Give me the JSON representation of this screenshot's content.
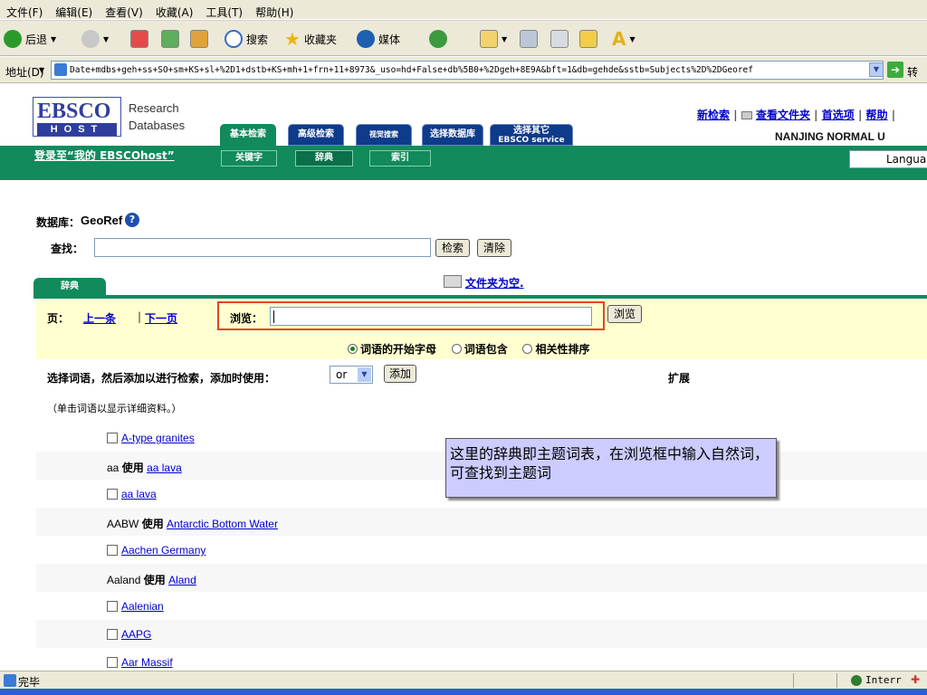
{
  "menubar": [
    "文件(F)",
    "编辑(E)",
    "查看(V)",
    "收藏(A)",
    "工具(T)",
    "帮助(H)"
  ],
  "toolbar": {
    "back": "后退",
    "search": "搜索",
    "favorites": "收藏夹",
    "media": "媒体"
  },
  "address": {
    "label": "地址(D)",
    "url": "Date+mdbs+geh+ss+SO+sm+KS+sl+%2D1+dstb+KS+mh+1+frn+11+8973&_uso=hd+False+db%5B0+%2Dgeh+8E9A&bft=1&db=gehde&sstb=Subjects%2D%2DGeoref",
    "go": "转"
  },
  "logo": {
    "brand": "EBSCO",
    "host": "HOST",
    "line1": "Research",
    "line2": "Databases"
  },
  "tabs": [
    "基本检索",
    "高级检索",
    "视觉搜索",
    "选择数据库",
    "选择其它",
    "EBSCO service"
  ],
  "toplinks": {
    "new_search": "新检索",
    "view_folder": "查看文件夹",
    "preferences": "首选项",
    "help": "帮助"
  },
  "institution": "NANJING NORMAL U",
  "login": "登录至“我的 EBSCOhost”",
  "subtabs": [
    "关键字",
    "辞典",
    "索引"
  ],
  "language": "Languag",
  "database": {
    "label": "数据库：",
    "name": "GeoRef"
  },
  "find": {
    "label": "查找：",
    "search_btn": "检索",
    "clear_btn": "清除"
  },
  "dict_tab": "辞典",
  "folder": "文件夹为空.",
  "pager": {
    "label": "页：",
    "prev": "上一条",
    "sep": "|",
    "next": "下一页"
  },
  "browse": {
    "label": "浏览：",
    "button": "浏览"
  },
  "radios": [
    "词语的开始字母",
    "词语包含",
    "相关性排序"
  ],
  "select": {
    "label": "选择词语，然后添加以进行检索，添加时使用：",
    "operator": "or",
    "add_btn": "添加",
    "expand": "扩展"
  },
  "hint": "（单击词语以显示详细资料。）",
  "terms": [
    {
      "term": "A-type granites"
    },
    {
      "prefix": "aa",
      "use": "使用",
      "term": "aa lava"
    },
    {
      "term": "aa lava"
    },
    {
      "prefix": "AABW",
      "use": "使用",
      "term": "Antarctic Bottom Water"
    },
    {
      "term": "Aachen Germany"
    },
    {
      "prefix": "Aaland",
      "use": "使用",
      "term": "Aland"
    },
    {
      "term": "Aalenian"
    },
    {
      "term": "AAPG"
    },
    {
      "term": "Aar Massif"
    }
  ],
  "callout": "这里的辞典即主题词表，在浏览框中输入自然词，可查找到主题词",
  "status": {
    "done": "完毕",
    "zone": "Interr"
  }
}
